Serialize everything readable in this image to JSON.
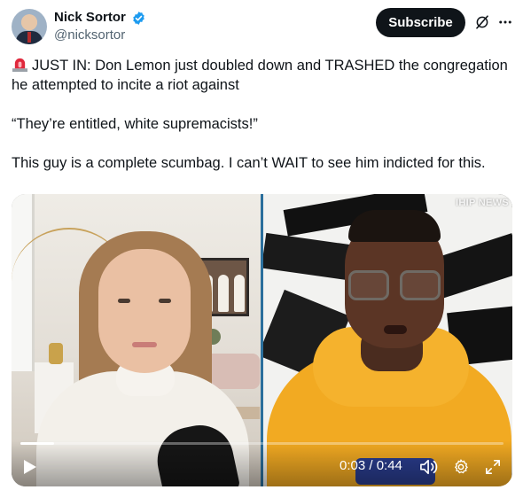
{
  "author": {
    "display_name": "Nick Sortor",
    "handle": "@nicksortor",
    "verified": true
  },
  "actions": {
    "subscribe_label": "Subscribe",
    "grok_icon": "grok-icon",
    "more_icon": "more-icon"
  },
  "tweet": {
    "line1": "JUST IN: Don Lemon just doubled down and TRASHED the congregation he attempted to incite a riot against",
    "line2": "“They’re entitled, white supremacists!”",
    "line3": "This guy is a complete scumbag. I can’t WAIT to see him indicted for this.",
    "emoji": "siren-icon"
  },
  "video": {
    "watermark": "IHIP NEWS",
    "current_time": "0:03",
    "duration": "0:44",
    "time_display": "0:03 / 0:44",
    "progress": 0.07,
    "state": "paused",
    "icons": [
      "play-icon",
      "volume-icon",
      "settings-icon",
      "fullscreen-icon"
    ]
  },
  "colors": {
    "accent_blue": "#1d9bf0",
    "text_primary": "#0f1419",
    "text_secondary": "#536471",
    "subscribe_bg": "#0f1419",
    "hoodie": "#f2aa22"
  }
}
